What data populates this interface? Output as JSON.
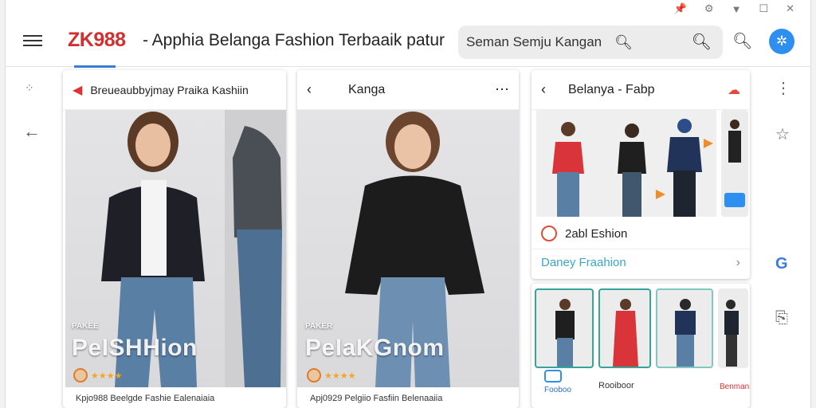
{
  "topbar": {
    "brand": "ZK988",
    "title": "- Apphia Belanga Fashion Terbaaik patur",
    "search_value": "Seman Semju Kangan"
  },
  "cards": [
    {
      "header": "Breueaubbyjmay Praika Kashiin",
      "watermark_small": "PAKEE",
      "watermark_big": "PeISHHion",
      "rating": "★★★★",
      "caption": "Kpjo988 Beelgde Fashie Ealenaiaia"
    },
    {
      "header": "Kanga",
      "watermark_small": "PAKER",
      "watermark_big": "PeIaKGnom",
      "rating": "★★★★",
      "caption": "Apj0929 Pelgiio Fasfiin Belenaaiia"
    },
    {
      "header": "Belanya - Fabp",
      "store_label": "2abl Eshion",
      "link_label": "Daney Fraahion",
      "bottom_labels": [
        "Fooboo",
        "Rooiboor",
        "Benmans"
      ]
    }
  ],
  "colors": {
    "brand_red": "#d32f2f",
    "accent_blue": "#3b7cd8",
    "avatar_blue": "#2f8ff0"
  }
}
